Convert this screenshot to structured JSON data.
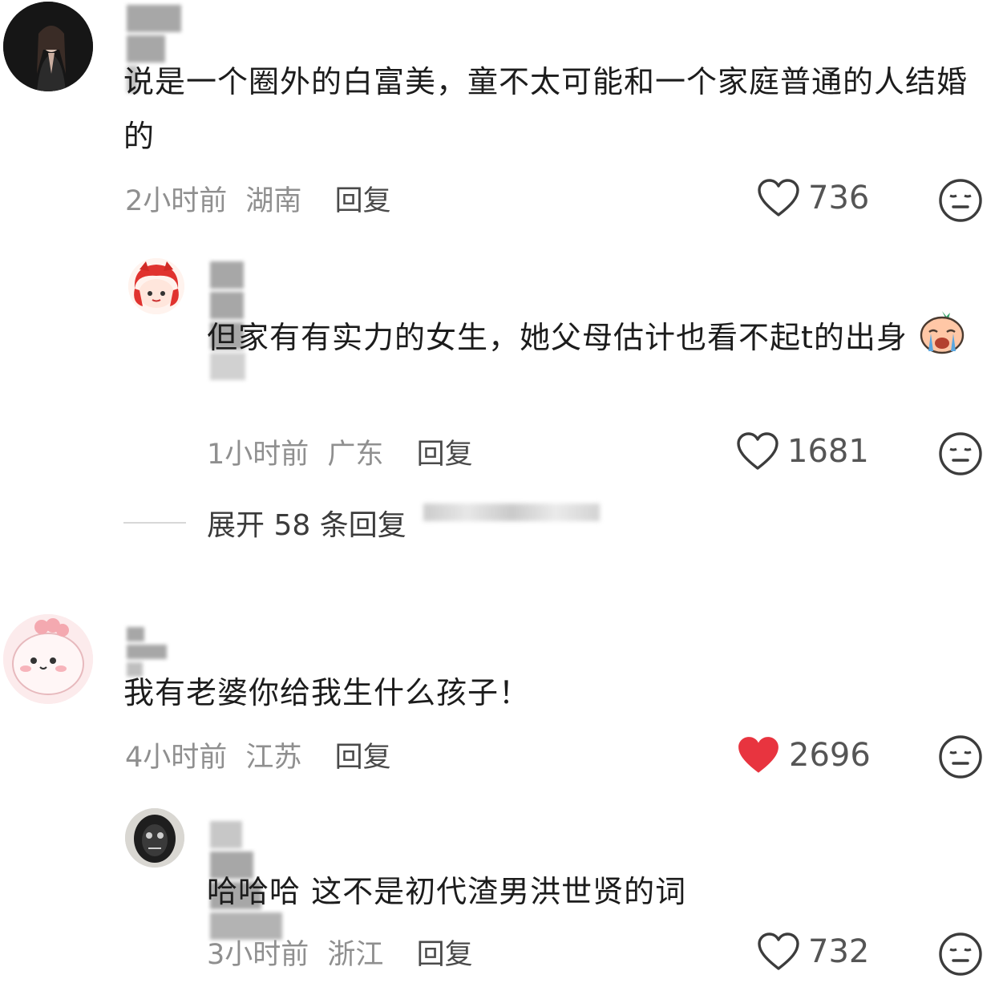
{
  "comments": [
    {
      "text": "说是一个圈外的白富美，童不太可能和一个家庭普通的人结婚的",
      "time": "2小时前",
      "location": "湖南",
      "reply_label": "回复",
      "likes": "736",
      "liked": false,
      "avatar_icon": "avatar-woman-icon"
    },
    {
      "text": "但家有有实力的女生，她父母估计也看不起t的出身",
      "time": "1小时前",
      "location": "广东",
      "reply_label": "回复",
      "likes": "1681",
      "liked": false,
      "avatar_icon": "avatar-red-cartoon-icon"
    },
    {
      "text": "我有老婆你给我生什么孩子！",
      "time": "4小时前",
      "location": "江苏",
      "reply_label": "回复",
      "likes": "2696",
      "liked": true,
      "avatar_icon": "avatar-pink-cartoon-icon"
    },
    {
      "text": "哈哈哈 这不是初代渣男洪世贤的词",
      "time": "3小时前",
      "location": "浙江",
      "reply_label": "回复",
      "likes": "732",
      "liked": false,
      "avatar_icon": "avatar-mask-icon"
    }
  ],
  "expand_replies": "展开 58 条回复",
  "colors": {
    "liked_heart": "#e8343f",
    "meta_text": "#8f8f8f",
    "body_text": "#1c1c1c"
  }
}
